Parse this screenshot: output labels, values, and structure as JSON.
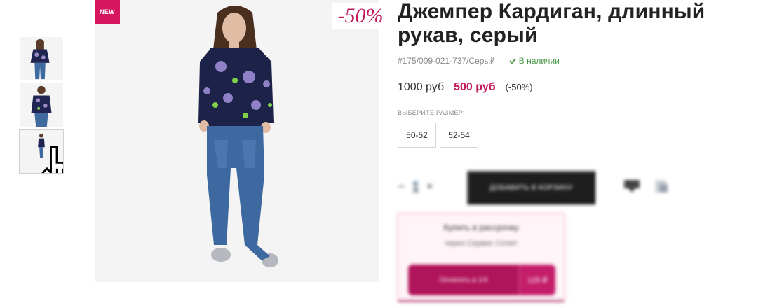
{
  "badges": {
    "new": "NEW",
    "discount": "-50%"
  },
  "product": {
    "title": "Джемпер Кардиган, длинный рукав, серый",
    "sku": "#175/009-021-737/Серый",
    "stock": "В наличии",
    "price_old": "1000 руб",
    "price_new": "500 руб",
    "discount": "(-50%)",
    "size_label": "ВЫБЕРИТЕ РАЗМЕР:",
    "sizes": [
      "50-52",
      "52-54"
    ]
  },
  "blurred": {
    "qty_value": "1",
    "cart_label": "ДОБАВИТЬ В КОРЗИНУ",
    "promo_title": "Купить в рассрочку",
    "promo_sub": "через Сервис Сплит",
    "promo_button": "Оплатить в 1/4",
    "promo_side": "125 ₽"
  },
  "colors": {
    "accent": "#c2185b",
    "badge": "#d6165f",
    "stock": "#4a9a4a",
    "cart": "#1e1e1e"
  },
  "icons": [
    "cursor-hand-icon",
    "check-icon",
    "minus-icon",
    "plus-icon",
    "compare-icon",
    "favorite-icon"
  ]
}
